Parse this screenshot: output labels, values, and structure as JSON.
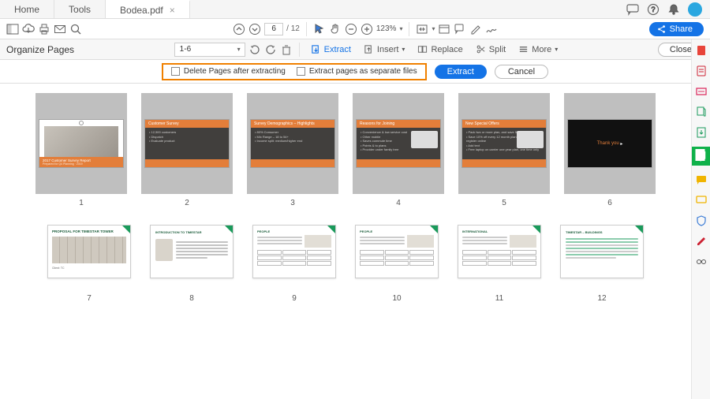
{
  "tabs": {
    "home": "Home",
    "tools": "Tools",
    "file": "Bodea.pdf"
  },
  "toolbar": {
    "page_current": "6",
    "page_total": "/ 12",
    "zoom": "123%",
    "share": "Share"
  },
  "organize": {
    "title": "Organize Pages",
    "range": "1-6",
    "extract": "Extract",
    "insert": "Insert",
    "replace": "Replace",
    "split": "Split",
    "more": "More",
    "close": "Close"
  },
  "extract_bar": {
    "delete_after": "Delete Pages after extracting",
    "separate": "Extract pages as separate files",
    "extract_btn": "Extract",
    "cancel_btn": "Cancel"
  },
  "thumbs_row1": [
    {
      "n": "1",
      "title": "2017 Customer Survey Report"
    },
    {
      "n": "2",
      "title": "Customer Survey",
      "bullets": [
        "12,500 customers",
        "Dispatch",
        "Evaluate product"
      ]
    },
    {
      "n": "3",
      "title": "Survey Demographics – Highlights",
      "bullets": [
        "80% Consumer",
        "Mix Range – 18 to 54+",
        "Income split: medium/higher end"
      ]
    },
    {
      "n": "4",
      "title": "Reasons for Joining",
      "bullets": [
        "Convenience & low service cost",
        "Other mobile",
        "Saves commute time",
        "Points & to plans",
        "Provider under family tree"
      ]
    },
    {
      "n": "5",
      "title": "New Special Offers",
      "bullets": [
        "Pack two or more plan, and save 5% per line",
        "Save 10% off every 12 month plan when you register online",
        "Add text",
        "Free laptop on carrier one year plan, one time only"
      ]
    },
    {
      "n": "6",
      "title": "Thank you"
    }
  ],
  "thumbs_row2": [
    {
      "n": "7",
      "title": "PROPOSAL FOR TIMESTAR TOWER",
      "sub": "Client: TC"
    },
    {
      "n": "8",
      "title": "INTRODUCTION TO TIMESTAR"
    },
    {
      "n": "9",
      "title": "PEOPLE"
    },
    {
      "n": "10",
      "title": "PEOPLE"
    },
    {
      "n": "11",
      "title": "INTERNATIONAL"
    },
    {
      "n": "12",
      "title": "TIMESTAR – BUILDINGS"
    }
  ],
  "rail_icons": [
    "pdf",
    "doc",
    "slide",
    "add-doc",
    "share-doc",
    "export",
    "comment",
    "stamp",
    "shield",
    "sign",
    "redact"
  ]
}
